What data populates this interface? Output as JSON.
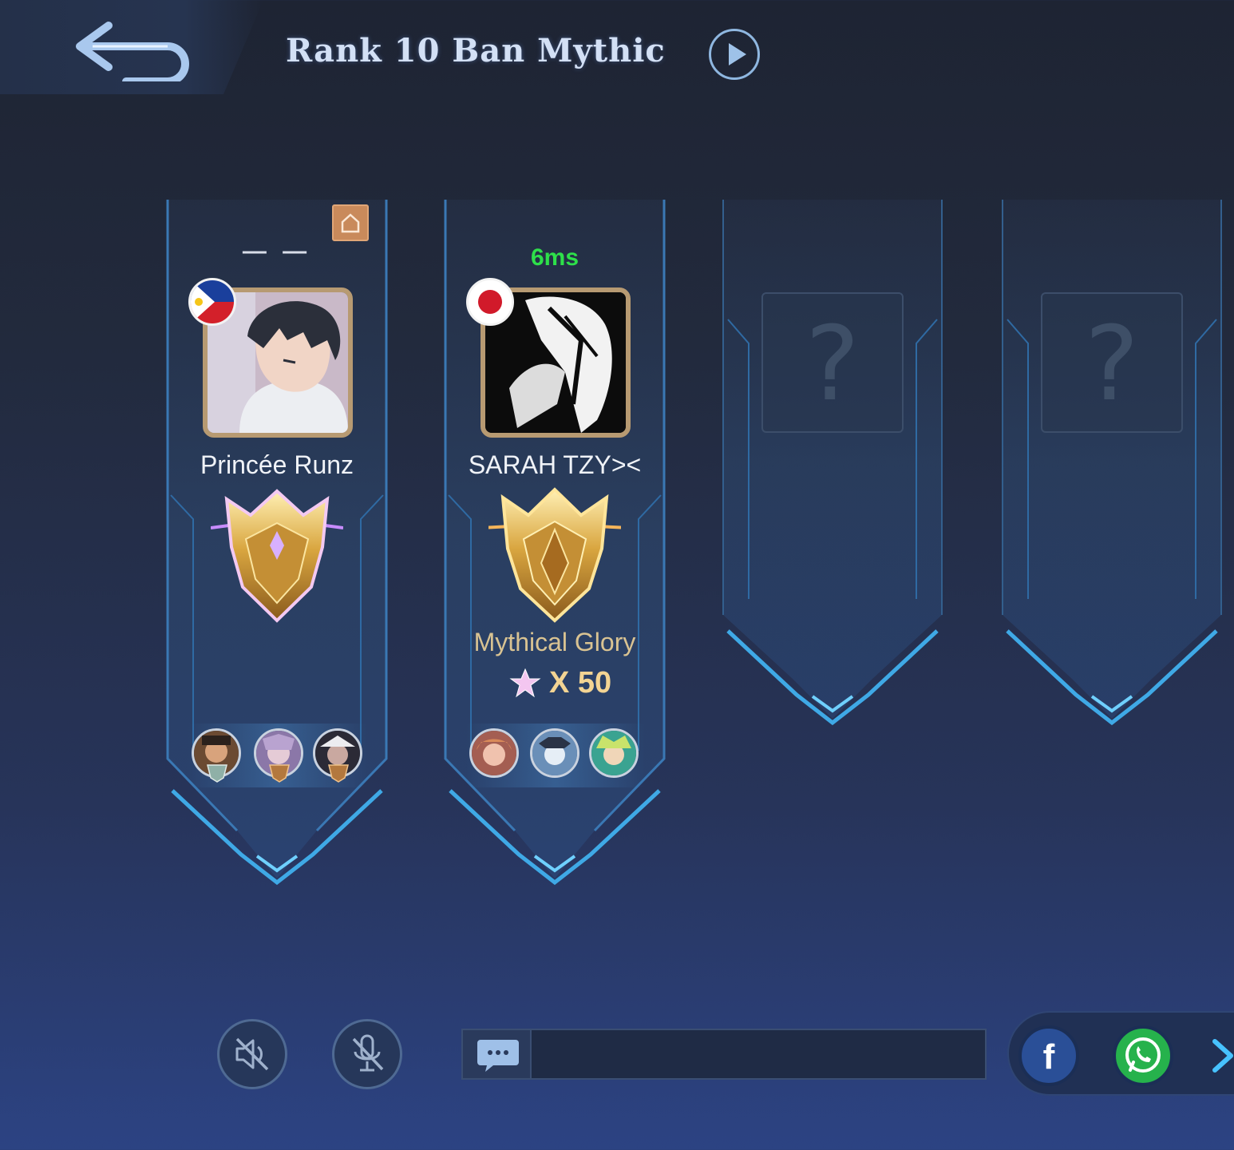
{
  "header": {
    "title": "Rank 10 Ban Mythic",
    "back_icon": "back-arrow-icon",
    "play_icon": "play-icon"
  },
  "players": [
    {
      "ping": "— —",
      "name": "Princée Runz",
      "flag": "philippines-flag",
      "avatar": "anime-boy-avatar",
      "has_home_badge": true,
      "rank_name": "",
      "heroes": [
        "hero-1",
        "hero-2",
        "hero-3"
      ]
    },
    {
      "ping": "6ms",
      "name": "SARAH TZY><",
      "flag": "japan-flag",
      "avatar": "monochrome-avatar",
      "has_home_badge": false,
      "rank_name": "Mythical Glory",
      "stars": "X 50",
      "heroes": [
        "hero-1",
        "hero-2",
        "hero-3"
      ]
    }
  ],
  "empty_slots": [
    {
      "placeholder": "?"
    },
    {
      "placeholder": "?"
    }
  ],
  "bottom": {
    "speaker_icon": "speaker-muted-icon",
    "mic_icon": "mic-muted-icon",
    "chat_icon": "chat-bubble-icon",
    "chat_placeholder": "",
    "share_facebook": "f",
    "share_whatsapp": "whatsapp-icon",
    "more_icon": "chevron-right-icon"
  },
  "colors": {
    "ping_good": "#2ee04a",
    "rank_text": "#d9c392",
    "title": "#d3e0f5",
    "frame_glow": "#3fa9e6"
  }
}
